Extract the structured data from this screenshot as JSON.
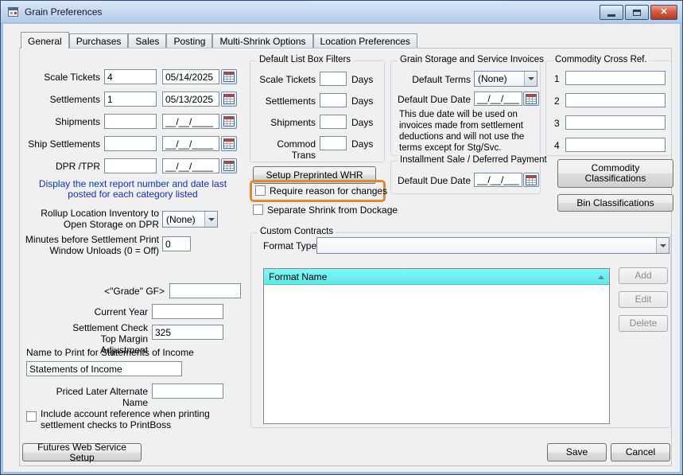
{
  "window": {
    "title": "Grain Preferences"
  },
  "tabs": [
    "General",
    "Purchases",
    "Sales",
    "Posting",
    "Multi-Shrink Options",
    "Location Preferences"
  ],
  "left": {
    "date_rows": [
      {
        "label": "Scale Tickets",
        "value": "4",
        "date": "05/14/2025"
      },
      {
        "label": "Settlements",
        "value": "1",
        "date": "05/13/2025"
      },
      {
        "label": "Shipments",
        "value": "",
        "date": "__/__/____"
      },
      {
        "label": "Ship Settlements",
        "value": "",
        "date": "__/__/____"
      },
      {
        "label": "DPR /TPR",
        "value": "",
        "date": "__/__/____"
      }
    ],
    "report_link": "Display the next report number and date last posted for each category listed",
    "rollup": {
      "label": "Rollup Location Inventory to Open Storage on DPR",
      "value": "(None)"
    },
    "minutes": {
      "label": "Minutes before Settlement Print Window Unloads (0 = Off)",
      "value": "0"
    },
    "grade": {
      "label": "<\"Grade\" GF>",
      "value": ""
    },
    "current_year": {
      "label": "Current Year",
      "value": ""
    },
    "margin": {
      "label": "Settlement Check Top Margin Adjustment",
      "value": "325"
    },
    "statements": {
      "label": "Name to Print for Statements of Income",
      "value": "Statements of Income"
    },
    "priced_later": {
      "label": "Priced Later Alternate Name",
      "value": ""
    },
    "printboss_checkbox": "Include account reference when printing settlement checks to PrintBoss",
    "futures_button": "Futures Web Service Setup"
  },
  "filters": {
    "title": "Default List Box Filters",
    "days_suffix": "Days",
    "rows": [
      {
        "label": "Scale Tickets",
        "value": ""
      },
      {
        "label": "Settlements",
        "value": ""
      },
      {
        "label": "Shipments",
        "value": ""
      },
      {
        "label": "Commod Trans",
        "value": ""
      }
    ]
  },
  "middle": {
    "setup_whr_button": "Setup Preprinted WHR",
    "require_reason": "Require reason for changes",
    "separate_shrink": "Separate Shrink from Dockage"
  },
  "custom_contracts": {
    "title": "Custom Contracts",
    "format_type_label": "Format Type",
    "format_type_value": "",
    "list_header": "Format Name",
    "add_button": "Add",
    "edit_button": "Edit",
    "delete_button": "Delete"
  },
  "invoices": {
    "title": "Grain Storage and Service Invoices",
    "default_terms_label": "Default Terms",
    "default_terms_value": "(None)",
    "due_date_label": "Default Due Date",
    "due_date_value": "__/__/____",
    "note": "This due date will be used on invoices made from settlement deductions and will not use the terms except for Stg/Svc."
  },
  "installment": {
    "title": "Installment Sale / Deferred Payment",
    "due_date_label": "Default Due Date",
    "due_date_value": "__/__/____"
  },
  "cross_ref": {
    "title": "Commodity Cross Ref.",
    "rows": [
      {
        "num": "1",
        "value": ""
      },
      {
        "num": "2",
        "value": ""
      },
      {
        "num": "3",
        "value": ""
      },
      {
        "num": "4",
        "value": ""
      }
    ],
    "commodity_class_button": "Commodity Classifications",
    "bin_class_button": "Bin Classifications"
  },
  "footer": {
    "save": "Save",
    "cancel": "Cancel"
  }
}
